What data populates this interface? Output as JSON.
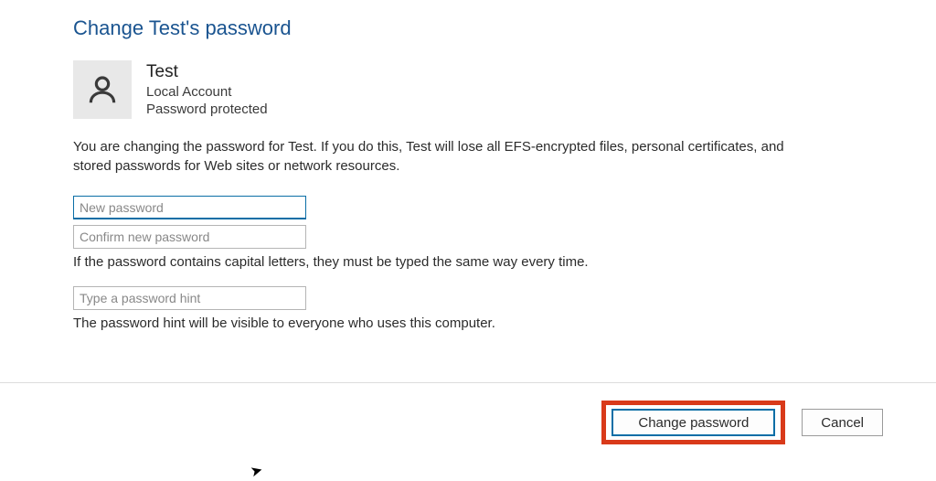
{
  "page": {
    "title": "Change Test's password"
  },
  "account": {
    "name": "Test",
    "type": "Local Account",
    "status": "Password protected"
  },
  "warning_text": "You are changing the password for Test.  If you do this, Test will lose all EFS-encrypted files, personal certificates, and stored passwords for Web sites or network resources.",
  "fields": {
    "new_password": {
      "placeholder": "New password",
      "value": ""
    },
    "confirm_password": {
      "placeholder": "Confirm new password",
      "value": ""
    },
    "hint": {
      "placeholder": "Type a password hint",
      "value": ""
    }
  },
  "help": {
    "caps": "If the password contains capital letters, they must be typed the same way every time.",
    "hint": "The password hint will be visible to everyone who uses this computer."
  },
  "buttons": {
    "change": "Change password",
    "cancel": "Cancel"
  },
  "colors": {
    "title": "#1a5490",
    "accent": "#0a6ea6",
    "highlight": "#d93a1a"
  }
}
